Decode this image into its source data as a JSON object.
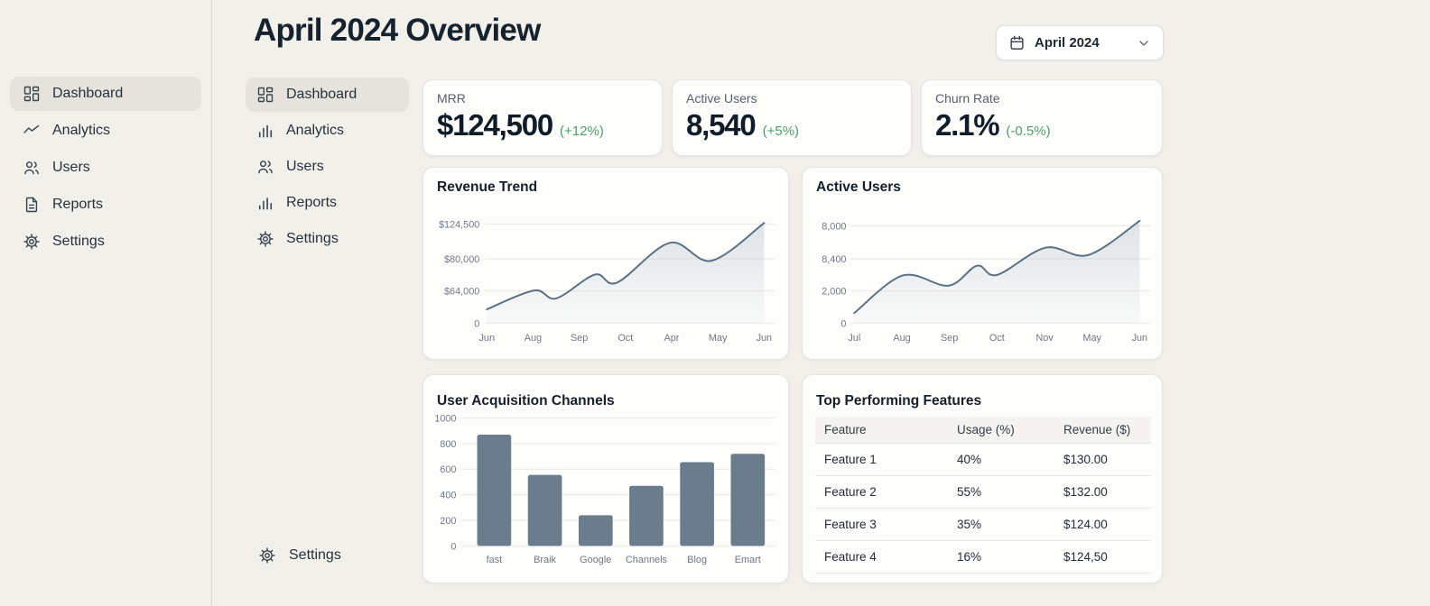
{
  "page_title": "April 2024 Overview",
  "date_selector": {
    "label": "April 2024"
  },
  "sidebar": {
    "items": [
      {
        "label": "Dashboard",
        "active": true
      },
      {
        "label": "Analytics",
        "active": false
      },
      {
        "label": "Users",
        "active": false
      },
      {
        "label": "Reports",
        "active": false
      },
      {
        "label": "Settings",
        "active": false
      }
    ]
  },
  "nav2": {
    "items": [
      {
        "label": "Dashboard",
        "active": true
      },
      {
        "label": "Analytics",
        "active": false
      },
      {
        "label": "Users",
        "active": false
      },
      {
        "label": "Reports",
        "active": false
      },
      {
        "label": "Settings",
        "active": false
      }
    ],
    "bottom_label": "Settings"
  },
  "kpis": [
    {
      "label": "MRR",
      "value": "$124,500",
      "change": "(+12%)"
    },
    {
      "label": "Active Users",
      "value": "8,540",
      "change": "(+5%)"
    },
    {
      "label": "Churn Rate",
      "value": "2.1%",
      "change": "(-0.5%)"
    }
  ],
  "colors": {
    "positive_green": "#4f9d6b",
    "chart_line": "#5d6f80",
    "chart_fill": "#8fa1b3",
    "bar_fill": "#6b7c8c",
    "grid": "#e9e8e3",
    "axis_text": "#717882"
  },
  "chart_data": [
    {
      "type": "line",
      "title": "Revenue Trend",
      "x_ticks": [
        "Jun",
        "Aug",
        "Sep",
        "Oct",
        "Apr",
        "May",
        "Jun"
      ],
      "y_ticks": [
        "$124,500",
        "$80,000",
        "$64,000",
        "0"
      ],
      "x_fracs": [
        0,
        0.17,
        0.25,
        0.39,
        0.47,
        0.66,
        0.81,
        1
      ],
      "y_fracs": [
        0.14,
        0.33,
        0.25,
        0.49,
        0.41,
        0.81,
        0.63,
        1.01
      ],
      "approx_values": [
        28000,
        64000,
        49000,
        72000,
        68000,
        100000,
        79000,
        124500
      ],
      "grid": true,
      "legend": false,
      "note": "smooth area line; y axis labeled nonlinearly 0 / $64,000 / $80,000 / $124,500 on evenly spaced gridlines"
    },
    {
      "type": "line",
      "title": "Active Users",
      "x_ticks": [
        "Jul",
        "Aug",
        "Sep",
        "Oct",
        "Nov",
        "May",
        "Jun"
      ],
      "y_ticks": [
        "8,000",
        "8,400",
        "2,000",
        "0"
      ],
      "x_fracs": [
        0,
        0.17,
        0.33,
        0.43,
        0.5,
        0.67,
        0.82,
        1
      ],
      "y_fracs": [
        0.105,
        0.49,
        0.385,
        0.59,
        0.495,
        0.775,
        0.7,
        1.05
      ],
      "approx_values": [
        640,
        5100,
        3060,
        7030,
        5190,
        8265,
        8350,
        8400
      ],
      "grid": true,
      "legend": false,
      "note": "smooth area line; y axis labeled nonlinearly 0 / 2,000 / 8,400 / 8,000 on evenly spaced gridlines"
    },
    {
      "type": "bar",
      "title": "User Acquisition Channels",
      "categories": [
        "fast",
        "Braik",
        "Google",
        "Channels",
        "Blog",
        "Emart"
      ],
      "values": [
        870,
        555,
        240,
        470,
        655,
        720
      ],
      "y_ticks": [
        "0",
        "200",
        "400",
        "600",
        "800",
        "1000"
      ],
      "ylim": [
        0,
        1000
      ],
      "grid": true,
      "legend": false
    },
    {
      "type": "table",
      "title": "Top Performing Features",
      "columns": [
        "Feature",
        "Usage (%)",
        "Revenue ($)"
      ],
      "rows": [
        [
          "Feature 1",
          "40%",
          "$130.00"
        ],
        [
          "Feature 2",
          "55%",
          "$132.00"
        ],
        [
          "Feature 3",
          "35%",
          "$124.00"
        ],
        [
          "Feature 4",
          "16%",
          "$124,50"
        ]
      ]
    }
  ]
}
